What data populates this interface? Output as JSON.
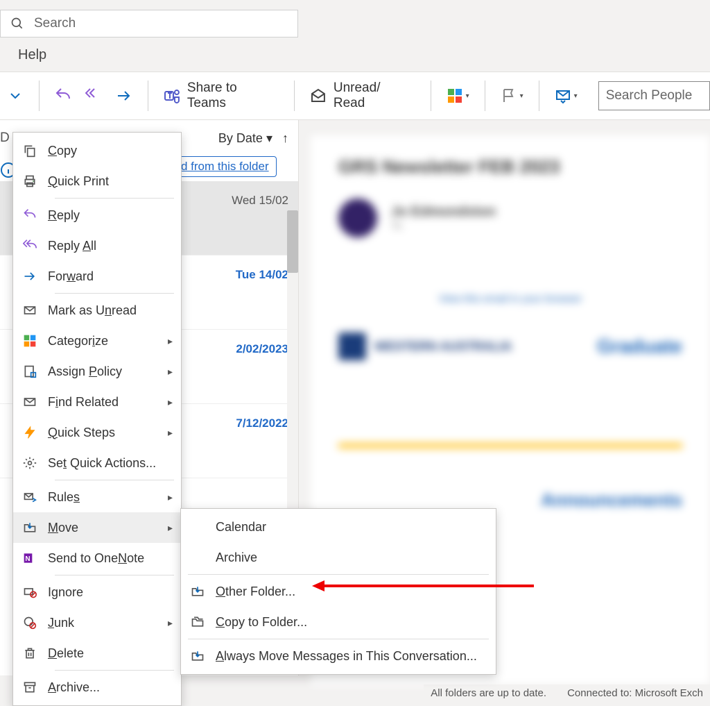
{
  "search": {
    "placeholder": "Search",
    "people_placeholder": "Search People"
  },
  "menubar": {
    "help": "Help"
  },
  "ribbon": {
    "share_to_teams": "Share to Teams",
    "unread_read": "Unread/ Read"
  },
  "list": {
    "sort_label": "By Date",
    "unread_link": "d from this folder",
    "rows": [
      {
        "date": "Wed 15/02",
        "selected": true
      },
      {
        "date": "Tue 14/02",
        "selected": false
      },
      {
        "date": "2/02/2023",
        "selected": false
      },
      {
        "date": "7/12/2022",
        "selected": false
      }
    ]
  },
  "preview": {
    "subject": "GRS Newsletter FEB 2023",
    "from": "Jo Edmondston",
    "banner_hint": "View this email in your browser",
    "org": "WESTERN AUSTRALIA",
    "right_text": "Graduate",
    "section": "Announcements"
  },
  "context_menu": {
    "copy": "Copy",
    "quick_print": "Quick Print",
    "reply": "Reply",
    "reply_all": "Reply All",
    "forward": "Forward",
    "mark_unread": "Mark as Unread",
    "categorize": "Categorize",
    "assign_policy": "Assign Policy",
    "find_related": "Find Related",
    "quick_steps": "Quick Steps",
    "set_quick_actions": "Set Quick Actions...",
    "rules": "Rules",
    "move": "Move",
    "send_onenote": "Send to OneNote",
    "ignore": "Ignore",
    "junk": "Junk",
    "delete": "Delete",
    "archive": "Archive..."
  },
  "move_submenu": {
    "calendar": "Calendar",
    "archive": "Archive",
    "other_folder": "Other Folder...",
    "copy_to_folder": "Copy to Folder...",
    "always_move": "Always Move Messages in This Conversation..."
  },
  "status": {
    "folders": "All folders are up to date.",
    "connected": "Connected to: Microsoft Exch"
  }
}
